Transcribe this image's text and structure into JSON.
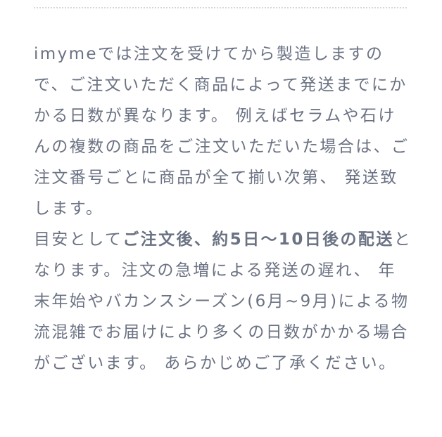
{
  "notice": {
    "paragraph1": "imymeでは注文を受けてから製造しますので、ご注文いただく商品によって発送までにかかる日数が異なります。 例えばセラムや石けんの複数の商品をご注文いただいた場合は、ご注文番号ごとに商品が全て揃い次第、 発送致します。",
    "paragraph2_before": "目安として",
    "paragraph2_bold": "ご注文後、約5日〜10日後の配送",
    "paragraph2_after": "となります。注文の急増による発送の遅れ、 年末年始やバカンスシーズン(6月~9月)による物流混雑でお届けにより多くの日数がかかる場合がございます。 あらかじめご了承ください。"
  }
}
